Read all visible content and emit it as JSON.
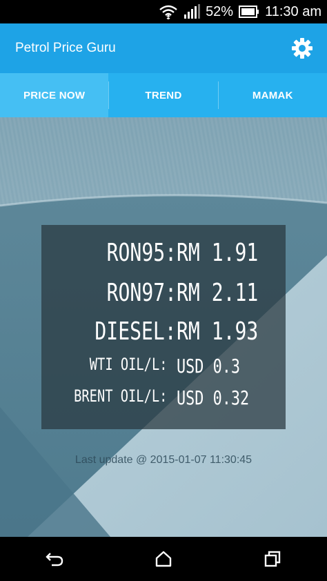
{
  "status_bar": {
    "battery_percent": "52%",
    "time": "11:30 am",
    "icons": [
      "wifi-icon",
      "signal-icon",
      "battery-icon"
    ]
  },
  "app_bar": {
    "title": "Petrol Price Guru",
    "settings_icon": "gear-icon"
  },
  "tabs": [
    {
      "label": "PRICE NOW",
      "active": true
    },
    {
      "label": "TREND",
      "active": false
    },
    {
      "label": "MAMAK",
      "active": false
    }
  ],
  "prices": {
    "ron95": {
      "label": "RON95:",
      "value": "RM 1.91"
    },
    "ron97": {
      "label": "RON97:",
      "value": "RM 2.11"
    },
    "diesel": {
      "label": "DIESEL:",
      "value": "RM 1.93"
    },
    "wti": {
      "label": "WTI OIL/L:",
      "value": "USD 0.3"
    },
    "brent": {
      "label": "BRENT OIL/L:",
      "value": "USD 0.32"
    }
  },
  "last_update": "Last update @ 2015-01-07 11:30:45",
  "nav_bar": {
    "icons": [
      "back-icon",
      "home-icon",
      "recents-icon"
    ]
  },
  "colors": {
    "app_bar": "#1ea3e6",
    "tab_bar": "#27b1ef",
    "tab_active": "#45bff3",
    "panel": "#28373e"
  }
}
